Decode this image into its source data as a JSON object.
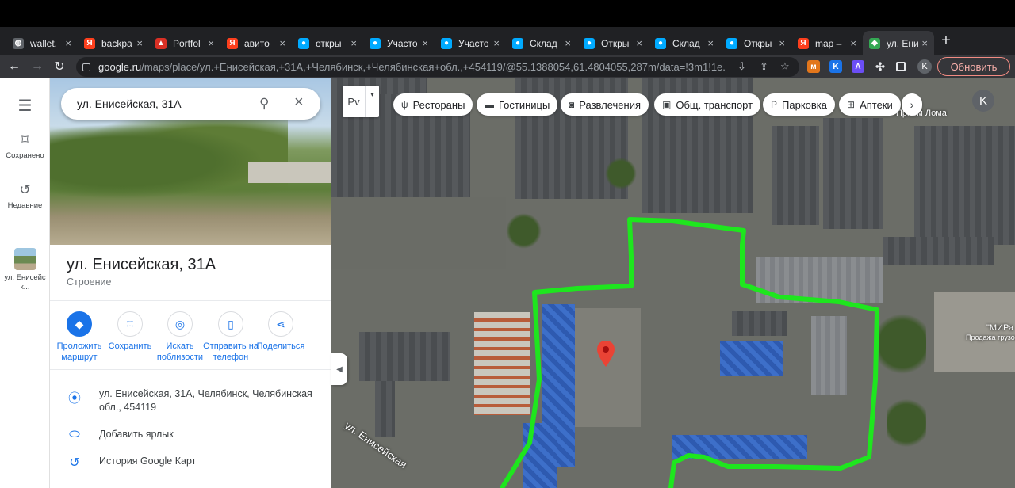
{
  "browser": {
    "tabs": [
      {
        "title": "wallet.",
        "favicon": "globe-icon",
        "color": "#5f6368",
        "glyph": "◍",
        "active": false
      },
      {
        "title": "backpa",
        "favicon": "yandex-icon",
        "color": "#fc3f1d",
        "glyph": "Я",
        "active": false
      },
      {
        "title": "Portfol",
        "favicon": "lock-doc-icon",
        "color": "#d93025",
        "glyph": "▲",
        "active": false
      },
      {
        "title": "авито",
        "favicon": "yandex-icon",
        "color": "#fc3f1d",
        "glyph": "Я",
        "active": false
      },
      {
        "title": "откры",
        "favicon": "avito-icon",
        "color": "#00aaff",
        "glyph": "●",
        "active": false
      },
      {
        "title": "Участо",
        "favicon": "avito-icon",
        "color": "#00aaff",
        "glyph": "●",
        "active": false
      },
      {
        "title": "Участо",
        "favicon": "avito-icon",
        "color": "#00aaff",
        "glyph": "●",
        "active": false
      },
      {
        "title": "Склад",
        "favicon": "avito-icon",
        "color": "#00aaff",
        "glyph": "●",
        "active": false
      },
      {
        "title": "Откры",
        "favicon": "avito-icon",
        "color": "#00aaff",
        "glyph": "●",
        "active": false
      },
      {
        "title": "Склад",
        "favicon": "avito-icon",
        "color": "#00aaff",
        "glyph": "●",
        "active": false
      },
      {
        "title": "Откры",
        "favicon": "avito-icon",
        "color": "#00aaff",
        "glyph": "●",
        "active": false
      },
      {
        "title": "map –",
        "favicon": "yandex-icon",
        "color": "#fc3f1d",
        "glyph": "Я",
        "active": false
      },
      {
        "title": "ул. Ени",
        "favicon": "google-maps-icon",
        "color": "#34a853",
        "glyph": "◆",
        "active": true
      }
    ],
    "url_host": "google.ru",
    "url_rest": "/maps/place/ул.+Енисейская,+31А,+Челябинск,+Челябинская+обл.,+454119/@55.1388054,61.4804055,287m/data=!3m1!1e...",
    "profile_initial": "K",
    "update_label": "Обновить"
  },
  "rail": {
    "menu_label": "",
    "saved_label": "Сохранено",
    "recent_label": "Недавние",
    "recent_place_label": "ул. Енисейск..."
  },
  "panel": {
    "search_value": "ул. Енисейская, 31А",
    "title": "ул. Енисейская, 31А",
    "type": "Строение",
    "actions": [
      {
        "label": "Проложить маршрут",
        "icon": "directions-icon",
        "glyph": "◆",
        "primary": true
      },
      {
        "label": "Сохранить",
        "icon": "bookmark-icon",
        "glyph": "⌑",
        "primary": false
      },
      {
        "label": "Искать поблизости",
        "icon": "nearby-icon",
        "glyph": "◎",
        "primary": false
      },
      {
        "label": "Отправить на телефон",
        "icon": "send-to-phone-icon",
        "glyph": "▯",
        "primary": false
      },
      {
        "label": "Поделиться",
        "icon": "share-icon",
        "glyph": "⋖",
        "primary": false
      }
    ],
    "address": "ул. Енисейская, 31А, Челябинск, Челябинская обл., 454119",
    "add_label": "Добавить ярлык",
    "history": "История Google Карт"
  },
  "map": {
    "layer_label": "Pv",
    "chips": [
      {
        "label": "Рестораны",
        "icon": "restaurant-icon",
        "glyph": "ψ"
      },
      {
        "label": "Гостиницы",
        "icon": "hotel-icon",
        "glyph": "▬"
      },
      {
        "label": "Развлечения",
        "icon": "camera-icon",
        "glyph": "◙"
      },
      {
        "label": "Общ. транспорт",
        "icon": "transit-icon",
        "glyph": "▣"
      },
      {
        "label": "Парковка",
        "icon": "parking-icon",
        "glyph": "P"
      },
      {
        "label": "Аптеки",
        "icon": "pharmacy-icon",
        "glyph": "⊞"
      }
    ],
    "account_initial": "K",
    "street_label": "ул. Енисейская",
    "poi_1": "Прием Лома",
    "poi_2": "\"МИРа",
    "poi_3": "Продажа грузовы",
    "outline_color": "#1ee61e",
    "pin_color": "#ea4335"
  }
}
